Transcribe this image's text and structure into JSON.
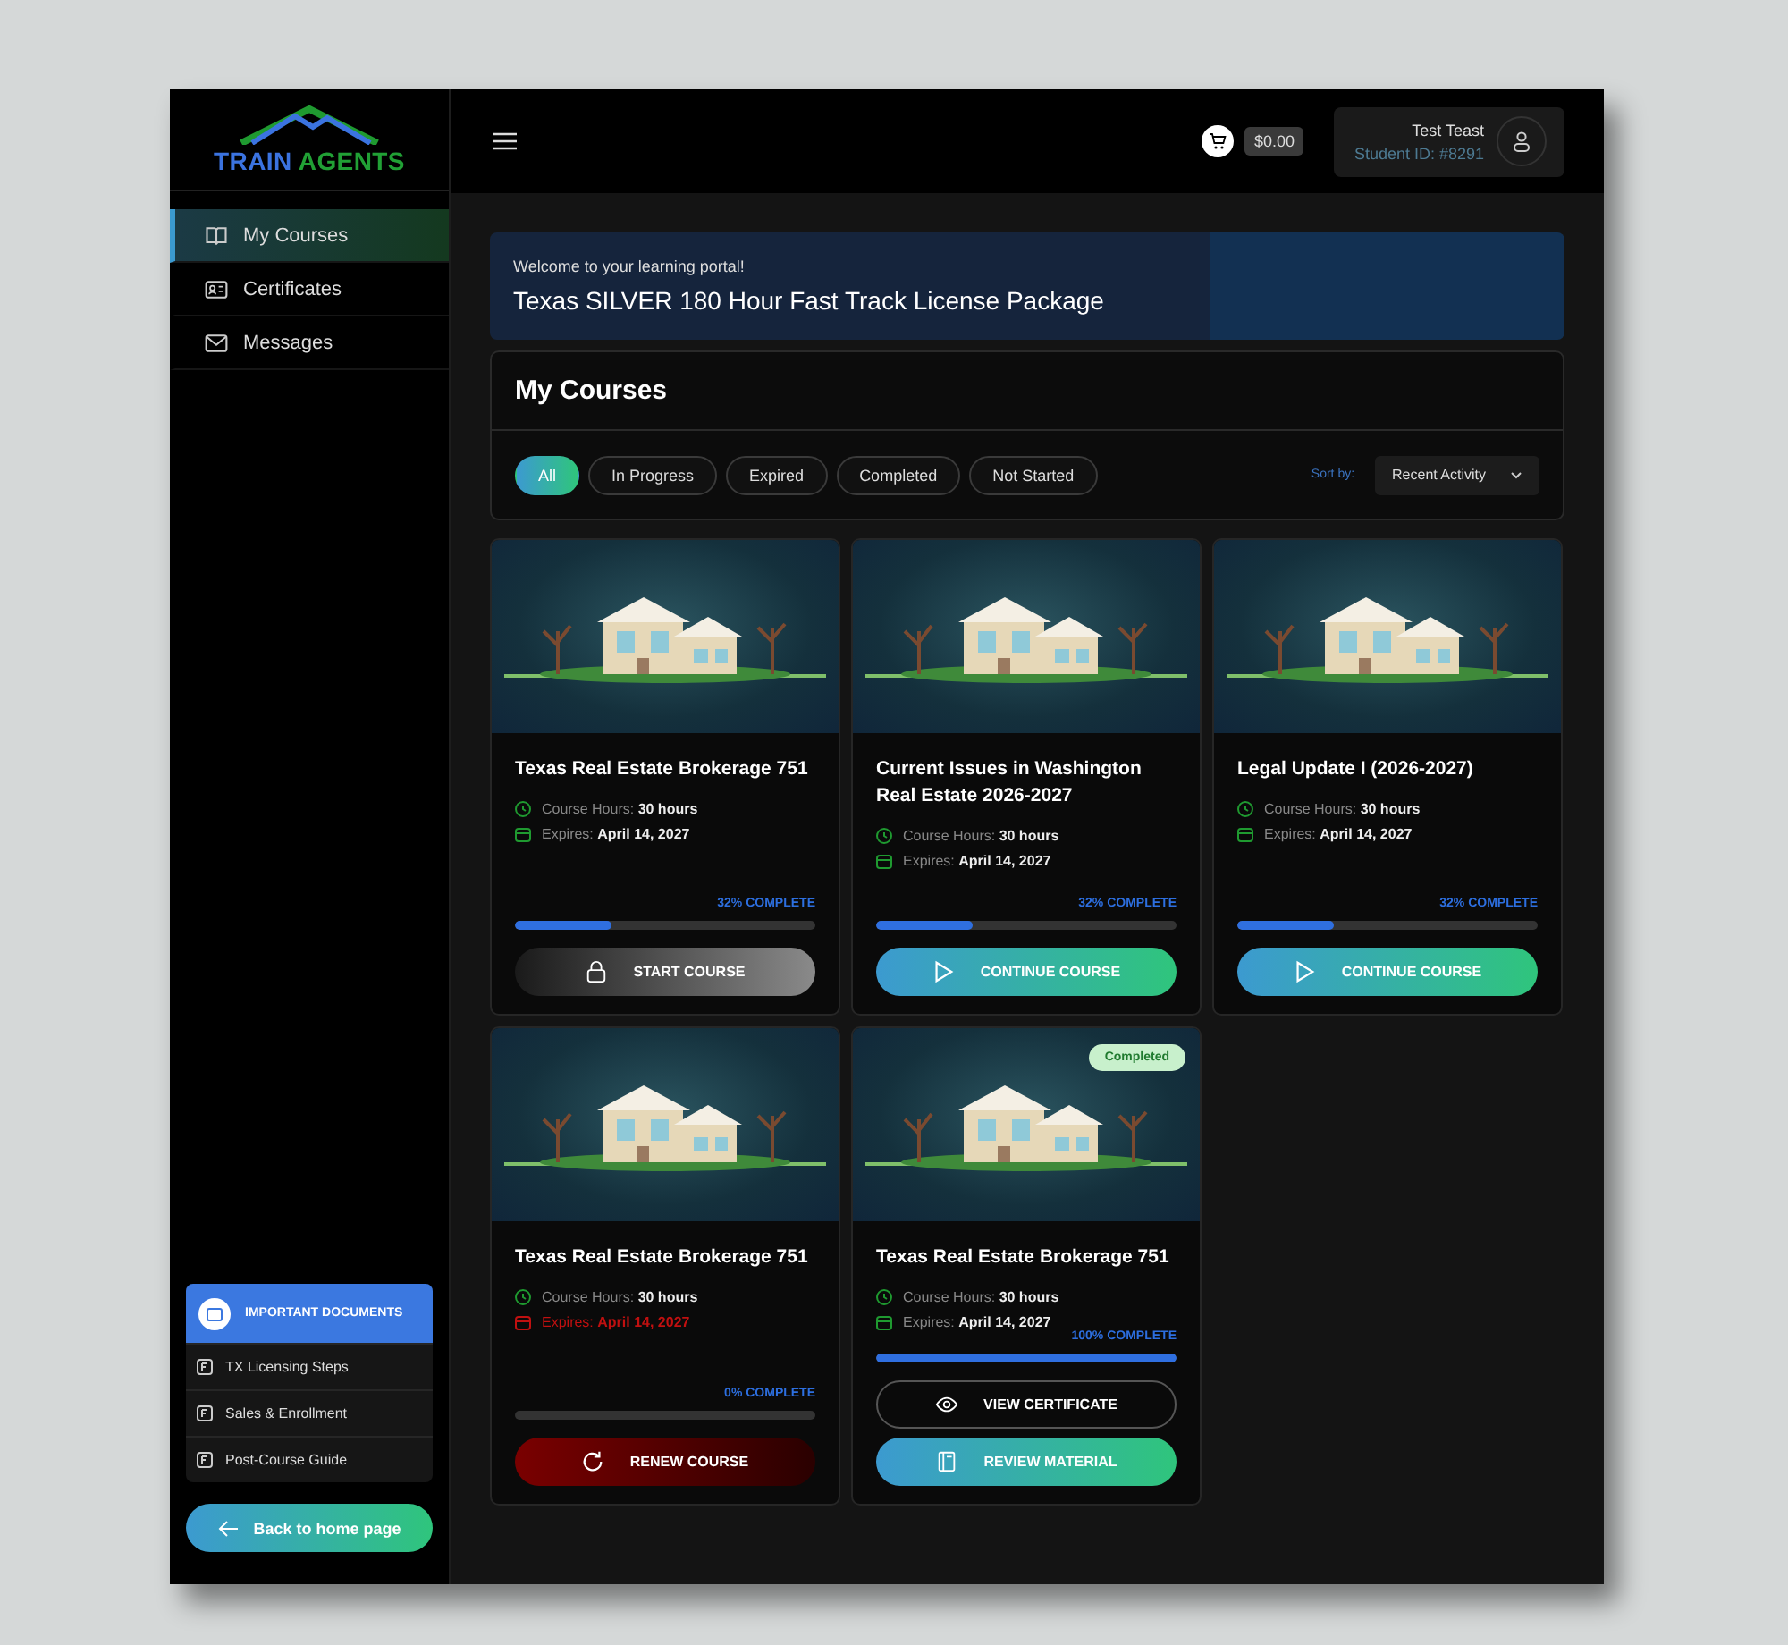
{
  "logo": {
    "primary": "TRAIN",
    "secondary": "AGENTS"
  },
  "sidebar": {
    "items": [
      {
        "label": "My Courses",
        "selected": true
      },
      {
        "label": "Certificates",
        "selected": false
      },
      {
        "label": "Messages",
        "selected": false
      }
    ],
    "documents": {
      "title": "IMPORTANT DOCUMENTS",
      "items": [
        "TX Licensing Steps",
        "Sales & Enrollment",
        "Post-Course Guide"
      ]
    },
    "back_button": "Back to home page"
  },
  "topbar": {
    "cart_total": "$0.00",
    "user_name": "Test Teast",
    "student_id": "Student ID: #8291"
  },
  "banner": {
    "greeting": "Welcome to your learning portal!",
    "title": "Texas SILVER 180 Hour Fast Track License Package"
  },
  "courses_panel": {
    "title": "My Courses",
    "filters": [
      {
        "label": "All",
        "selected": true
      },
      {
        "label": "In Progress",
        "selected": false
      },
      {
        "label": "Expired",
        "selected": false
      },
      {
        "label": "Completed",
        "selected": false
      },
      {
        "label": "Not Started",
        "selected": false
      }
    ],
    "sort_label": "Sort by:",
    "sort_value": "Recent Activity"
  },
  "courses": [
    {
      "title": "Texas Real Estate Brokerage 751",
      "hours_label": "Course Hours:",
      "hours": "30 hours",
      "expires_label": "Expires:",
      "expires": "April 14, 2027",
      "expired": false,
      "progress": "32% COMPLETE",
      "level": 0.32,
      "buttons": [
        {
          "label": "START COURSE",
          "kind": "start"
        }
      ]
    },
    {
      "title": "Current Issues in Washington Real Estate 2026-2027",
      "hours_label": "Course Hours:",
      "hours": "30 hours",
      "expires_label": "Expires:",
      "expires": "April 14, 2027",
      "expired": false,
      "progress": "32% COMPLETE",
      "level": 0.32,
      "buttons": [
        {
          "label": "CONTINUE COURSE",
          "kind": "continue"
        }
      ]
    },
    {
      "title": "Legal Update I (2026-2027)",
      "hours_label": "Course Hours:",
      "hours": "30 hours",
      "expires_label": "Expires:",
      "expires": "April 14, 2027",
      "expired": false,
      "progress": "32% COMPLETE",
      "level": 0.32,
      "buttons": [
        {
          "label": "CONTINUE COURSE",
          "kind": "continue"
        }
      ]
    },
    {
      "title": "Texas Real Estate Brokerage 751",
      "hours_label": "Course Hours:",
      "hours": "30 hours",
      "expires_label": "Expires:",
      "expires": "April 14, 2027",
      "expired": true,
      "progress": "0% COMPLETE",
      "level": 0,
      "buttons": [
        {
          "label": "RENEW COURSE",
          "kind": "renew"
        }
      ]
    },
    {
      "title": "Texas Real Estate Brokerage 751",
      "badge": "Completed",
      "hours_label": "Course Hours:",
      "hours": "30 hours",
      "expires_label": "Expires:",
      "expires": "April 14, 2027",
      "expired": false,
      "progress": "100% COMPLETE",
      "level": 1,
      "buttons": [
        {
          "label": "VIEW CERTIFICATE",
          "kind": "certificate"
        },
        {
          "label": "REVIEW MATERIAL",
          "kind": "review"
        }
      ]
    }
  ]
}
